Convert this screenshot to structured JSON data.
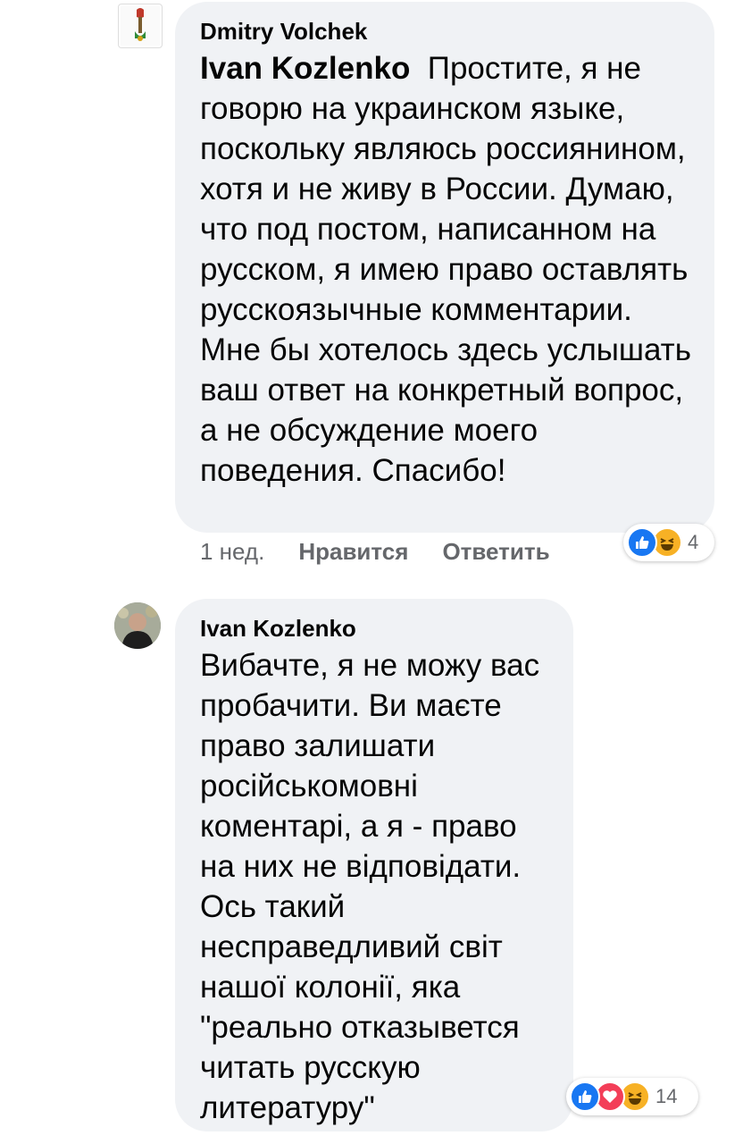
{
  "comments": [
    {
      "author": "Dmitry Volchek",
      "mention": "Ivan Kozlenko",
      "text": "Простите, я не говорю на украинском языке, поскольку являюсь россиянином, хотя и не живу в России. Думаю, что под постом, написанном на русском, я имею право оставлять русскоязычные комментарии. Мне бы хотелось здесь услышать ваш ответ на конкретный вопрос, а не обсуждение моего поведения. Спасибо!",
      "time": "1 нед.",
      "like_label": "Нравится",
      "reply_label": "Ответить",
      "reaction_count": "4",
      "reactions": [
        "like-icon",
        "haha-icon"
      ]
    },
    {
      "author": "Ivan Kozlenko",
      "text": "Вибачте, я не можу вас пробачити. Ви маєте право залишати російськомовні коментарі, а я - право на них не відповідати. Ось такий несправедливий світ нашої колонії, яка \"реально отказывется читать русскую литературу\"",
      "reaction_count": "14",
      "reactions": [
        "like-icon",
        "love-icon",
        "haha-icon"
      ]
    }
  ],
  "colors": {
    "bubble": "#f0f2f5",
    "text": "#050505",
    "meta": "#65676b",
    "like": "#1877f2",
    "love": "#f33e58",
    "haha": "#f7b125"
  }
}
